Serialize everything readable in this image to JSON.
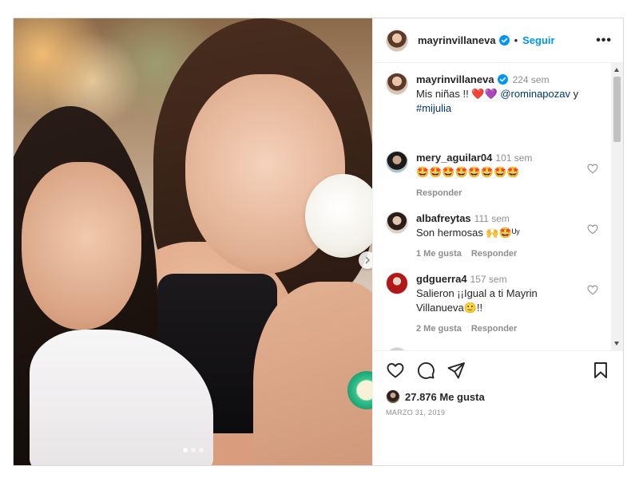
{
  "post": {
    "username": "mayrinvillaneva",
    "follow_label": "Seguir",
    "separator": "•",
    "more_label": "•••"
  },
  "caption": {
    "author": "mayrinvillaneva",
    "time": "224 sem",
    "text_start": "Mis niñas !! ",
    "emojis": "❤️💜",
    "mention": "@rominapozav",
    "conj": " y ",
    "hashtag": "#mijulia"
  },
  "comments": [
    {
      "author": "mery_aguilar04",
      "time": "101 sem",
      "text": "🤩🤩🤩🤩🤩🤩🤩🤩",
      "likes": "",
      "reply": "Responder"
    },
    {
      "author": "albafreytas",
      "time": "111 sem",
      "text": "Son hermosas 🙌🤩ᵁʸ",
      "likes": "1 Me gusta",
      "reply": "Responder"
    },
    {
      "author": "gdguerra4",
      "time": "157 sem",
      "text": "Salieron ¡¡Igual a ti Mayrin Villanueva🙂!!",
      "likes": "2 Me gusta",
      "reply": "Responder"
    }
  ],
  "likes_text": "27.876 Me gusta",
  "date": "MARZO 31, 2019",
  "carousel": {
    "slides": 3,
    "active": 1
  },
  "colors": {
    "link": "#0095f6",
    "verified": "#0095f6",
    "muted": "#8e8e8e",
    "mention": "#00376b"
  },
  "icons": [
    "heart-icon",
    "comment-icon",
    "share-icon",
    "bookmark-icon",
    "more-icon",
    "verified-badge-icon",
    "chevron-right-icon"
  ]
}
